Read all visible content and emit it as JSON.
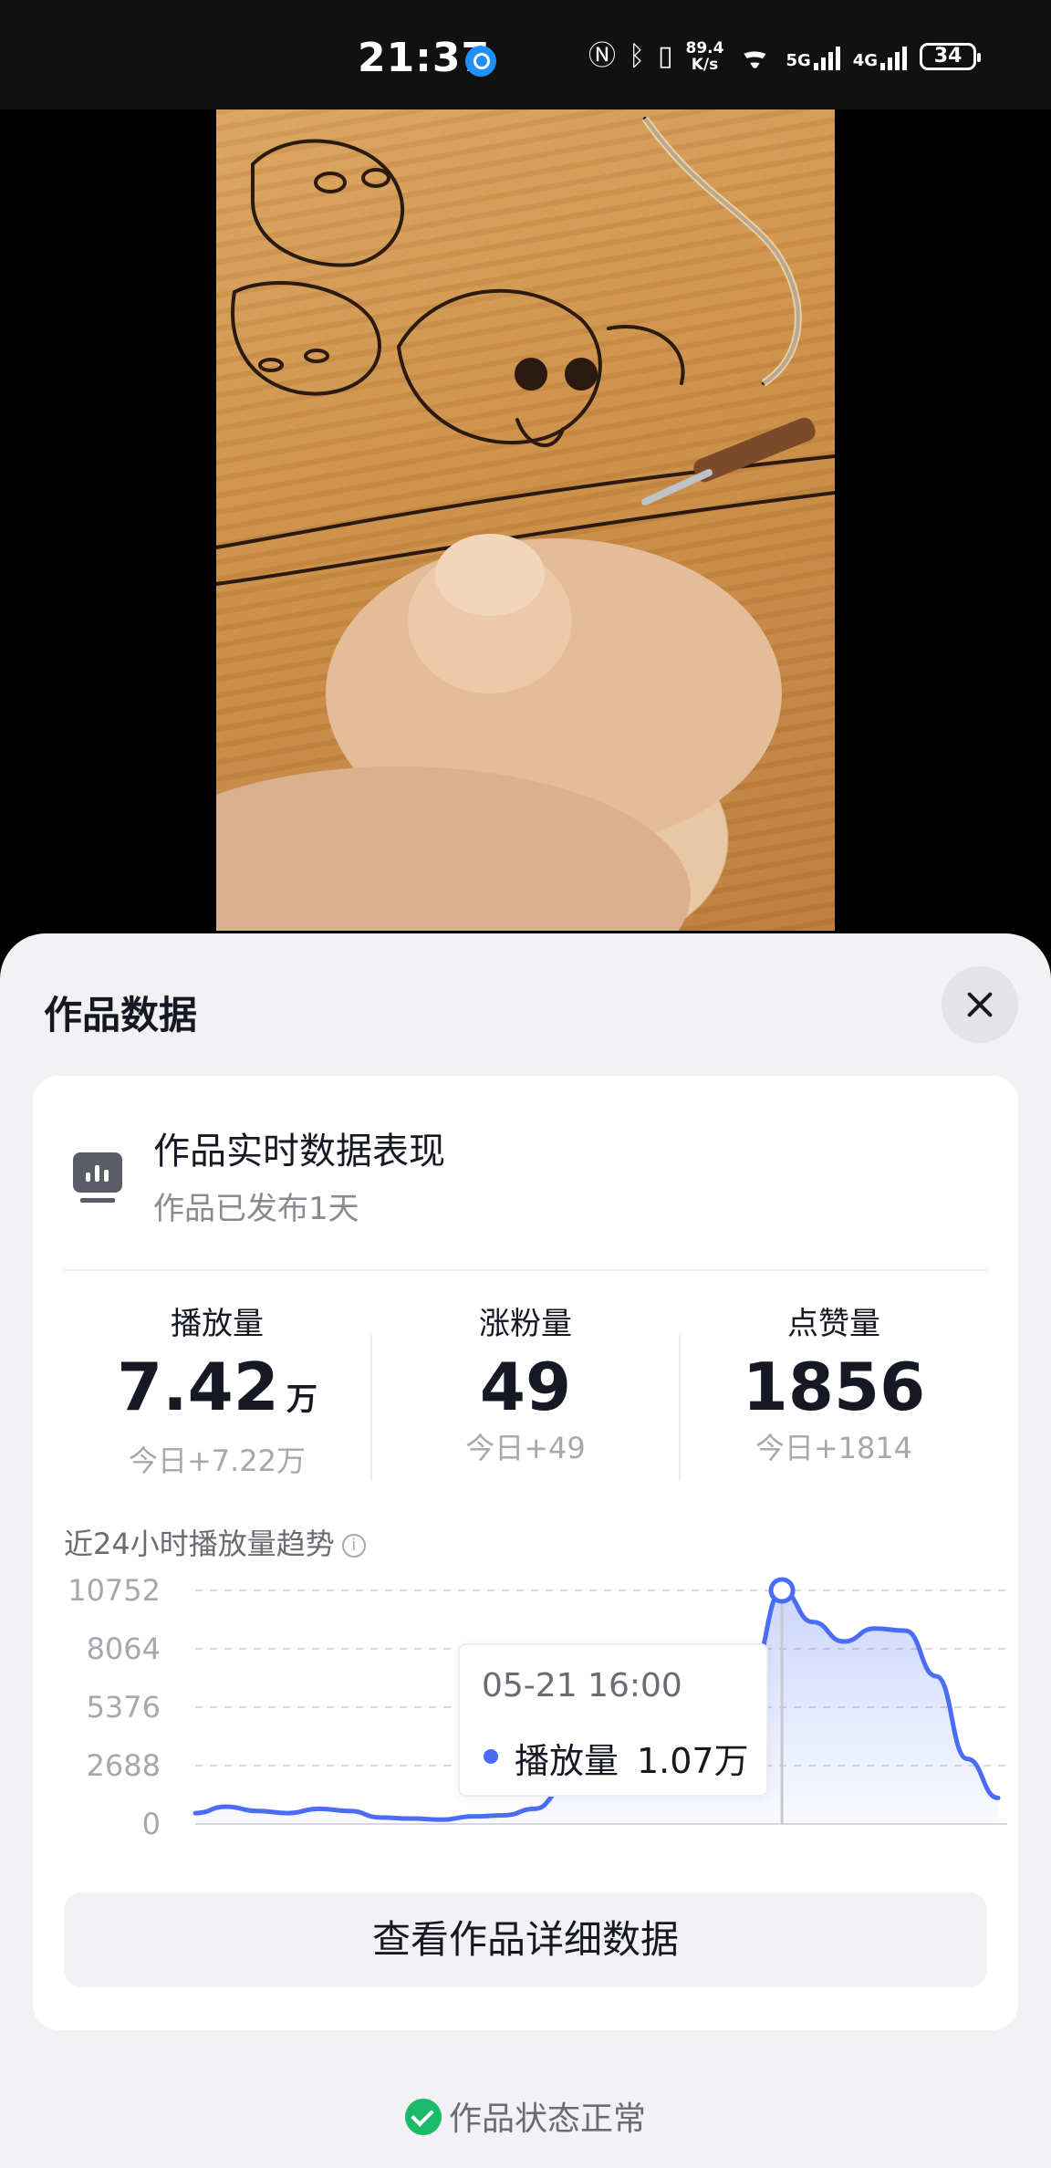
{
  "status_bar": {
    "time": "21:37",
    "net_speed_value": "89.4",
    "net_speed_unit": "K/s",
    "net_label_1": "5G",
    "net_label_2": "4G",
    "battery": "34"
  },
  "sheet": {
    "title": "作品数据",
    "close_icon": "close-icon"
  },
  "card": {
    "heading": "作品实时数据表现",
    "subheading": "作品已发布1天"
  },
  "metrics": [
    {
      "label": "播放量",
      "value": "7.42",
      "unit": "万",
      "today": "今日+7.22万"
    },
    {
      "label": "涨粉量",
      "value": "49",
      "unit": "",
      "today": "今日+49"
    },
    {
      "label": "点赞量",
      "value": "1856",
      "unit": "",
      "today": "今日+1814"
    }
  ],
  "trend": {
    "title": "近24小时播放量趋势",
    "info_icon": "i"
  },
  "chart_data": {
    "type": "area",
    "y_ticks": [
      "10752",
      "8064",
      "5376",
      "2688",
      "0"
    ],
    "ylim": [
      0,
      10752
    ],
    "grid": true,
    "series": [
      {
        "name": "播放量",
        "color": "#4a6cf7",
        "values": [
          500,
          800,
          600,
          500,
          700,
          600,
          300,
          250,
          200,
          350,
          400,
          700,
          1700,
          1900,
          3300,
          2000,
          2600,
          5000,
          7000,
          10752,
          9300,
          8400,
          9000,
          8900,
          6800,
          3000,
          1200
        ]
      }
    ],
    "highlight_index": 19
  },
  "tooltip": {
    "time": "05-21 16:00",
    "label": "播放量",
    "value": "1.07万"
  },
  "detail_button": "查看作品详细数据",
  "footer_status": "作品状态正常"
}
